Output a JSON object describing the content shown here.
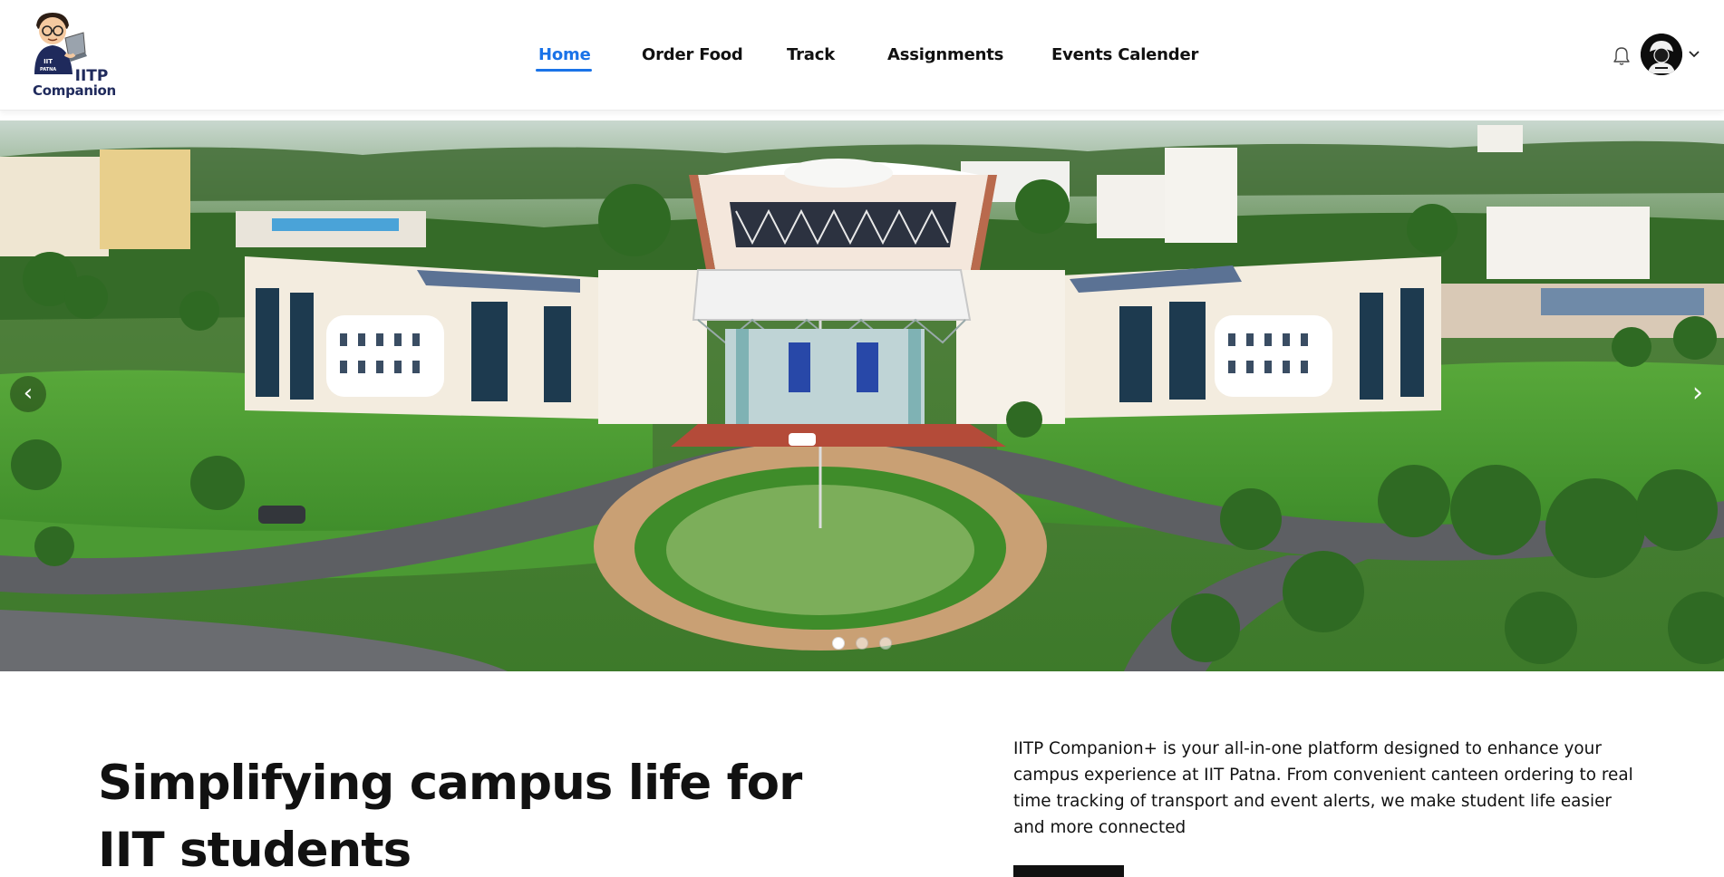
{
  "header": {
    "logo": {
      "text_line1": "IITP",
      "text_line2": "Companion",
      "badge_line1": "IIT",
      "badge_line2": "PATNA"
    },
    "nav": [
      {
        "label": "Home",
        "active": true
      },
      {
        "label": "Order Food",
        "active": false
      },
      {
        "label": "Track",
        "active": false
      },
      {
        "label": "Assignments",
        "active": false
      },
      {
        "label": "Events Calender",
        "active": false
      }
    ],
    "icons": {
      "notification": "bell-icon",
      "profile": "avatar",
      "menu": "chevron-down-icon"
    },
    "accent_color": "#1a73e8"
  },
  "hero": {
    "image": "aerial view of IIT Patna campus",
    "arrows": {
      "prev": "‹",
      "next": "›"
    },
    "slides_total": 3,
    "active_slide": 1
  },
  "intro": {
    "headline": "Simplifying campus life for IIT students",
    "description": "IITP Companion+ is your all-in-one platform designed to enhance your campus experience at IIT Patna. From convenient canteen ordering to real time tracking of transport and event alerts, we make student life easier and more connected"
  }
}
